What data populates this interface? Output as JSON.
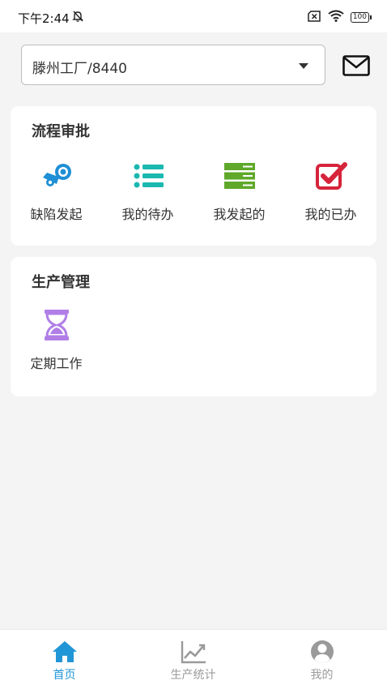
{
  "status_bar": {
    "time": "下午2:44",
    "battery": "100"
  },
  "header": {
    "factory_select": {
      "value": "滕州工厂/8440"
    },
    "mail_icon": "mail-icon"
  },
  "sections": {
    "approval": {
      "title": "流程审批",
      "items": [
        {
          "label": "缺陷发起",
          "icon": "steam-icon",
          "color": "#1f8fd6"
        },
        {
          "label": "我的待办",
          "icon": "list-icon",
          "color": "#1bb8b0"
        },
        {
          "label": "我发起的",
          "icon": "server-icon",
          "color": "#5fa82a"
        },
        {
          "label": "我的已办",
          "icon": "check-square-icon",
          "color": "#d6243a"
        }
      ]
    },
    "production": {
      "title": "生产管理",
      "items": [
        {
          "label": "定期工作",
          "icon": "hourglass-icon",
          "color": "#b07ee6"
        }
      ]
    }
  },
  "tab_bar": {
    "tabs": [
      {
        "label": "首页",
        "icon": "home-icon",
        "active": true
      },
      {
        "label": "生产统计",
        "icon": "chart-icon",
        "active": false
      },
      {
        "label": "我的",
        "icon": "user-icon",
        "active": false
      }
    ],
    "active_color": "#2196d6",
    "inactive_color": "#9a9a9a"
  }
}
